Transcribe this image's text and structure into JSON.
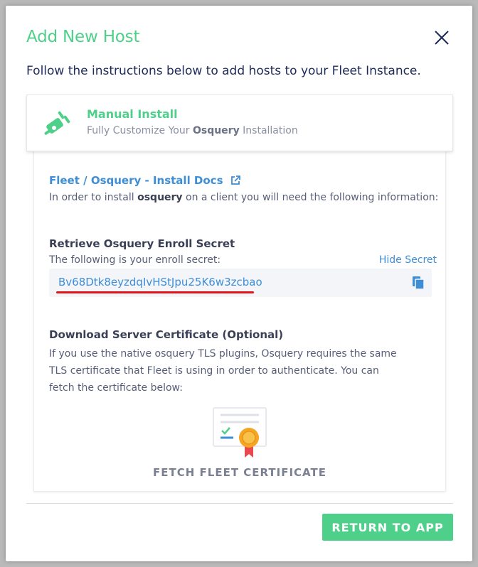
{
  "modal": {
    "title": "Add New Host",
    "intro": "Follow the instructions below to add hosts to your Fleet Instance."
  },
  "method": {
    "title": "Manual Install",
    "sub_prefix": "Fully Customize Your ",
    "sub_bold": "Osquery",
    "sub_suffix": " Installation",
    "icon": "plug-icon"
  },
  "docs": {
    "link_label": "Fleet / Osquery - Install Docs",
    "desc_prefix": "In order to install ",
    "desc_bold": "osquery",
    "desc_suffix": " on a client you will need the following information:"
  },
  "secret": {
    "title": "Retrieve Osquery Enroll Secret",
    "desc": "The following is your enroll secret:",
    "hide_label": "Hide Secret",
    "value": "Bv68Dtk8eyzdqIvHStJpu25K6w3zcbao"
  },
  "certificate": {
    "title": "Download Server Certificate (Optional)",
    "desc": "If you use the native osquery TLS plugins, Osquery requires the same TLS certificate that Fleet is using in order to authenticate. You can fetch the certificate below:",
    "fetch_label": "FETCH FLEET CERTIFICATE"
  },
  "footer": {
    "return_label": "RETURN TO APP"
  },
  "colors": {
    "accent": "#4fd08a",
    "link": "#3e8ed6",
    "annotation": "#e0141b"
  }
}
